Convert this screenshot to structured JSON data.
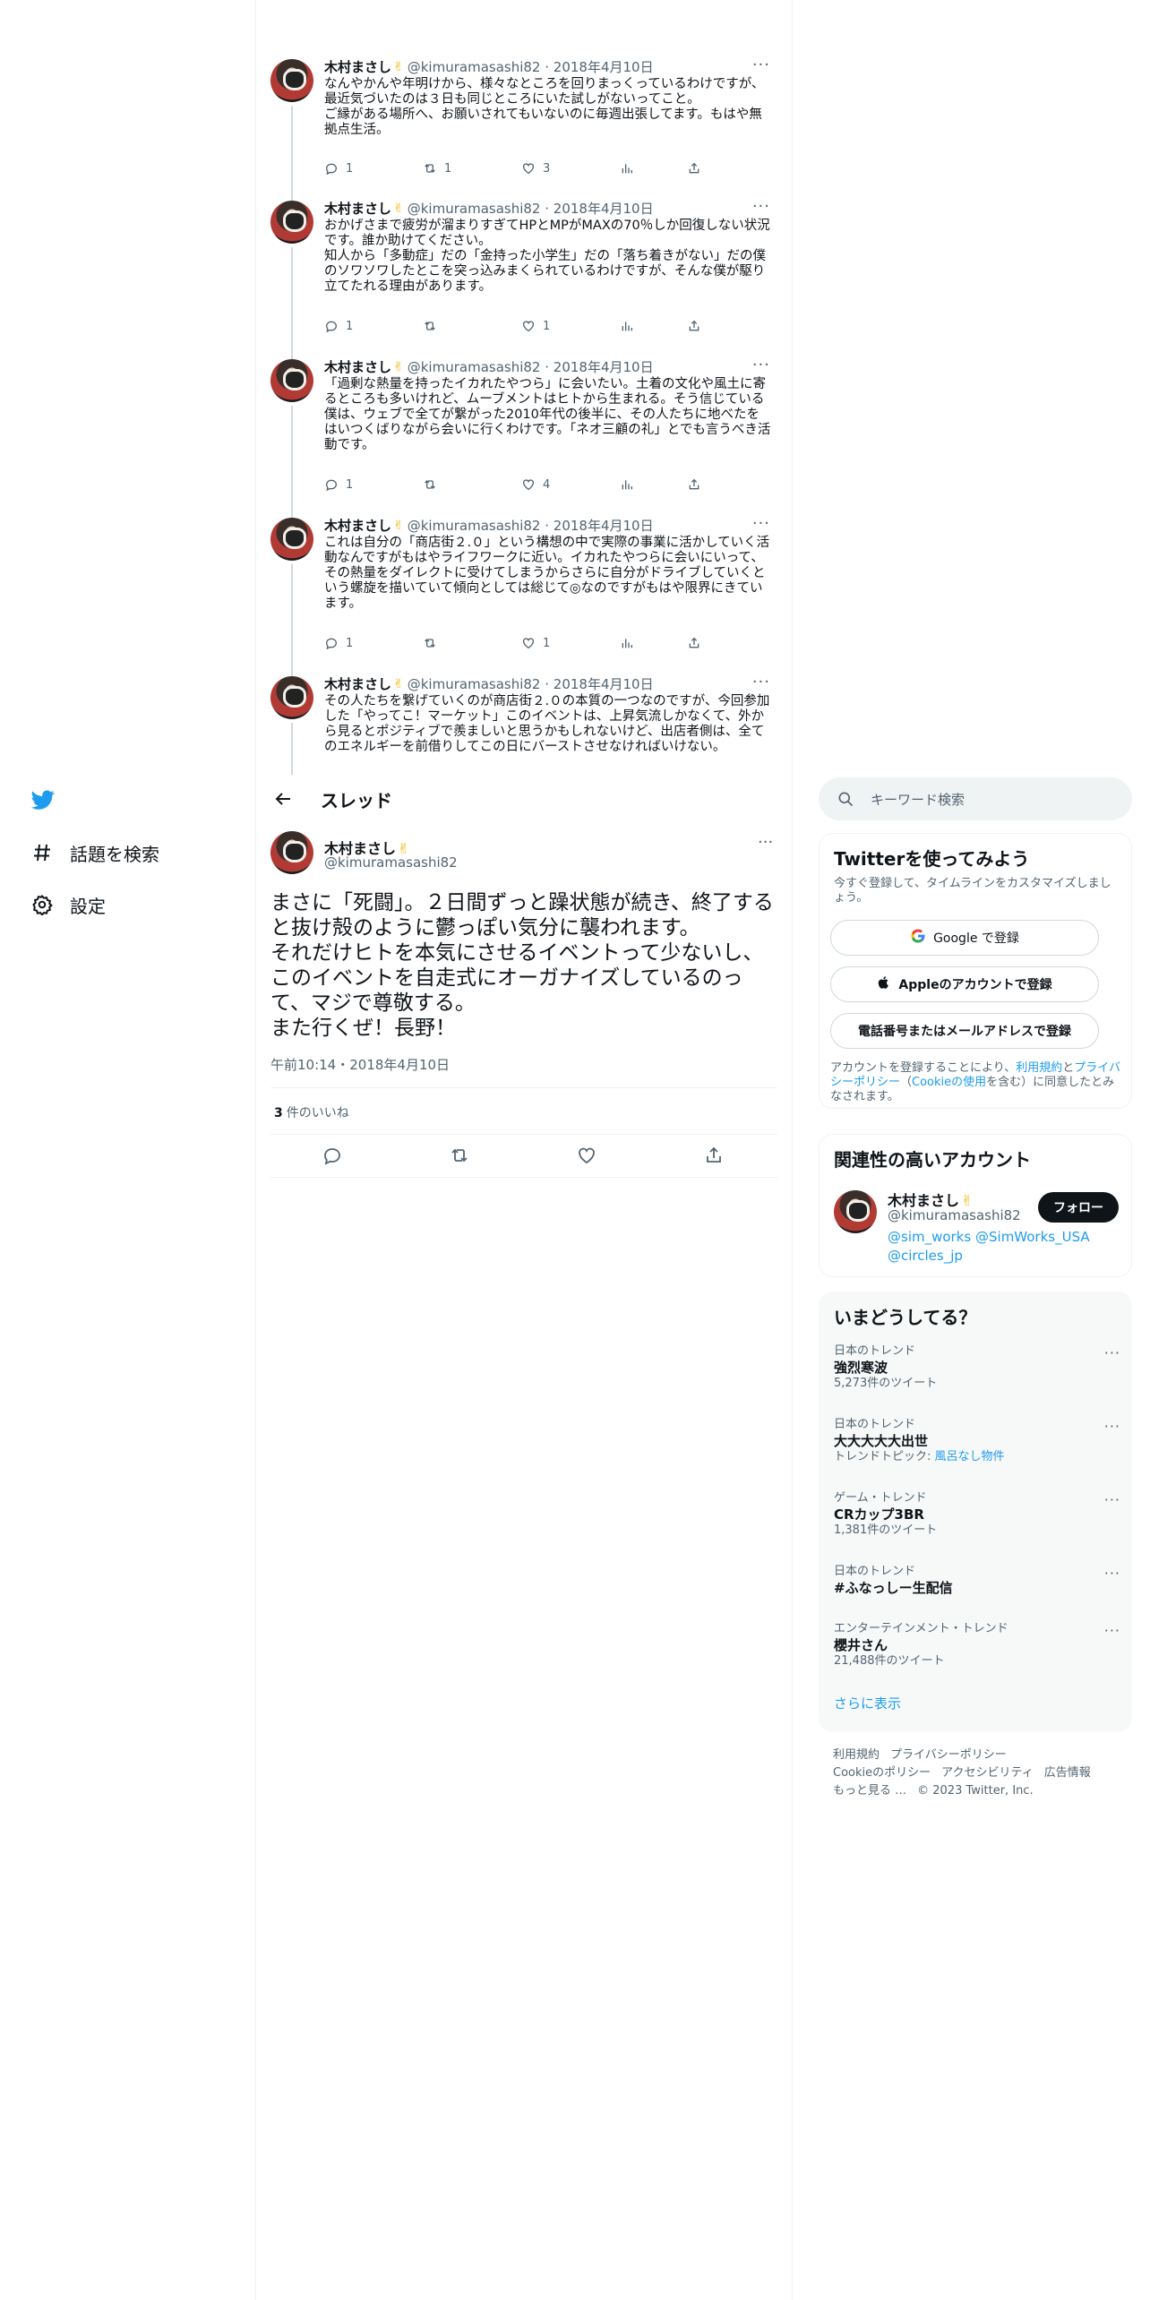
{
  "nav": {
    "explore_label": "話題を検索",
    "settings_label": "設定"
  },
  "header": {
    "title": "スレッド"
  },
  "thread": [
    {
      "name": "木村まさし",
      "handle": "@kimuramasashi82",
      "date": "2018年4月10日",
      "text": "なんやかんや年明けから、様々なところを回りまっくっているわけですが、最近気づいたのは３日も同じところにいた試しがないってこと。\nご縁がある場所へ、お願いされてもいないのに毎週出張してます。もはや無拠点生活。",
      "reply_count": "1",
      "retweet_count": "1",
      "like_count": "3"
    },
    {
      "name": "木村まさし",
      "handle": "@kimuramasashi82",
      "date": "2018年4月10日",
      "text": "おかげさまで疲労が溜まりすぎてHPとMPがMAXの70％しか回復しない状況です。誰か助けてください。\n知人から「多動症」だの「金持った小学生」だの「落ち着きがない」だの僕のソワソワしたとこを突っ込みまくられているわけですが、そんな僕が駆り立てたれる理由があります。",
      "reply_count": "1",
      "retweet_count": "",
      "like_count": "1"
    },
    {
      "name": "木村まさし",
      "handle": "@kimuramasashi82",
      "date": "2018年4月10日",
      "text": "「過剰な熱量を持ったイカれたやつら」に会いたい。土着の文化や風土に寄るところも多いけれど、ムーブメントはヒトから生まれる。そう信じている僕は、ウェブで全てが繋がった2010年代の後半に、その人たちに地べたをはいつくばりながら会いに行くわけです。「ネオ三顧の礼」とでも言うべき活動です。",
      "reply_count": "1",
      "retweet_count": "",
      "like_count": "4"
    },
    {
      "name": "木村まさし",
      "handle": "@kimuramasashi82",
      "date": "2018年4月10日",
      "text": "これは自分の「商店街２.０」という構想の中で実際の事業に活かしていく活動なんですがもはやライフワークに近い。イカれたやつらに会いにいって、その熱量をダイレクトに受けてしまうからさらに自分がドライブしていくという螺旋を描いていて傾向としては総じて◎なのですがもはや限界にきています。",
      "reply_count": "1",
      "retweet_count": "",
      "like_count": "1"
    },
    {
      "name": "木村まさし",
      "handle": "@kimuramasashi82",
      "date": "2018年4月10日",
      "text": "その人たちを繋げていくのが商店街２.０の本質の一つなのですが、今回参加した「やってこ！マーケット」このイベントは、上昇気流しかなくて、外から見るとポジティブで羨ましいと思うかもしれないけど、出店者側は、全てのエネルギーを前借りしてこの日にバーストさせなければいけない。",
      "reply_count": "",
      "retweet_count": "",
      "like_count": ""
    }
  ],
  "main_tweet": {
    "name": "木村まさし",
    "handle": "@kimuramasashi82",
    "text": "まさに「死闘」。２日間ずっと躁状態が続き、終了すると抜け殻のように鬱っぽい気分に襲われます。\nそれだけヒトを本気にさせるイベントって少ないし、このイベントを自走式にオーガナイズしているのって、マジで尊敬する。\nまた行くぜ！長野！",
    "time": "午前10:14・2018年4月10日",
    "likes_count": "3",
    "likes_label": "件のいいね"
  },
  "search": {
    "placeholder": "キーワード検索"
  },
  "signup": {
    "title": "Twitterを使ってみよう",
    "subtitle": "今すぐ登録して、タイムラインをカスタマイズしましょう。",
    "google_label": "Google で登録",
    "apple_label": "Appleのアカウントで登録",
    "phone_label": "電話番号またはメールアドレスで登録",
    "legal_pre": "アカウントを登録することにより、",
    "legal_terms": "利用規約",
    "legal_and": "と",
    "legal_privacy": "プライバシーポリシー",
    "legal_open": "（",
    "legal_cookie": "Cookieの使用",
    "legal_post": "を含む）に同意したとみなされます。"
  },
  "related": {
    "title": "関連性の高いアカウント",
    "name": "木村まさし",
    "handle": "@kimuramasashi82",
    "follow_label": "フォロー",
    "bio_link1": "@sim_works",
    "bio_link2": "@SimWorks_USA",
    "bio_link3": "@circles_jp"
  },
  "trends": {
    "title": "いまどうしてる？",
    "items": [
      {
        "context": "日本のトレンド",
        "name": "強烈寒波",
        "count": "5,273件のツイート"
      },
      {
        "context": "日本のトレンド",
        "name": "大大大大大出世",
        "count_prefix": "トレンドトピック: ",
        "count_link": "風呂なし物件"
      },
      {
        "context": "ゲーム・トレンド",
        "name": "CRカップ3BR",
        "count": "1,381件のツイート"
      },
      {
        "context": "日本のトレンド",
        "name": "#ふなっしー生配信",
        "count": ""
      },
      {
        "context": "エンターテインメント・トレンド",
        "name": "櫻井さん",
        "count": "21,488件のツイート"
      }
    ],
    "show_more": "さらに表示"
  },
  "footer": {
    "terms": "利用規約",
    "privacy": "プライバシーポリシー",
    "cookie": "Cookieのポリシー",
    "accessibility": "アクセシビリティ",
    "ads": "広告情報",
    "more": "もっと見る …",
    "copyright": "© 2023 Twitter, Inc."
  },
  "colors": {
    "brand": "#1d9bf0",
    "text": "#0f1419",
    "muted": "#536471"
  }
}
